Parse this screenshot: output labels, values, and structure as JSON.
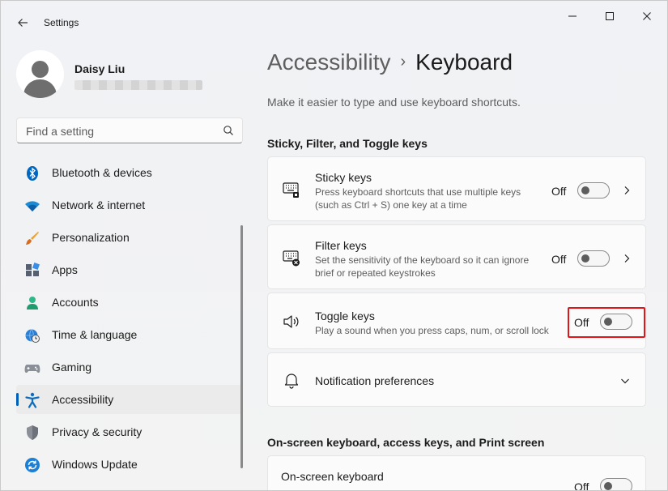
{
  "window": {
    "title": "Settings",
    "controls": {
      "minimize": "minimize",
      "maximize": "maximize",
      "close": "close"
    }
  },
  "user": {
    "name": "Daisy Liu"
  },
  "search": {
    "placeholder": "Find a setting"
  },
  "sidebar": {
    "items": [
      {
        "label": "Bluetooth & devices",
        "icon": "bluetooth-icon"
      },
      {
        "label": "Network & internet",
        "icon": "wifi-icon"
      },
      {
        "label": "Personalization",
        "icon": "brush-icon"
      },
      {
        "label": "Apps",
        "icon": "apps-icon"
      },
      {
        "label": "Accounts",
        "icon": "accounts-icon"
      },
      {
        "label": "Time & language",
        "icon": "globe-clock-icon"
      },
      {
        "label": "Gaming",
        "icon": "gamepad-icon"
      },
      {
        "label": "Accessibility",
        "icon": "accessibility-icon",
        "active": true
      },
      {
        "label": "Privacy & security",
        "icon": "shield-icon"
      },
      {
        "label": "Windows Update",
        "icon": "update-icon"
      }
    ]
  },
  "breadcrumb": {
    "parent": "Accessibility",
    "separator": "›",
    "current": "Keyboard"
  },
  "subtitle": "Make it easier to type and use keyboard shortcuts.",
  "sections": {
    "sticky": {
      "title": "Sticky, Filter, and Toggle keys"
    },
    "onscreen": {
      "title": "On-screen keyboard, access keys, and Print screen"
    }
  },
  "cards": {
    "sticky_keys": {
      "title": "Sticky keys",
      "desc": "Press keyboard shortcuts that use multiple keys (such as Ctrl + S) one key at a time",
      "state": "Off"
    },
    "filter_keys": {
      "title": "Filter keys",
      "desc": "Set the sensitivity of the keyboard so it can ignore brief or repeated keystrokes",
      "state": "Off"
    },
    "toggle_keys": {
      "title": "Toggle keys",
      "desc": "Play a sound when you press caps, num, or scroll lock",
      "state": "Off"
    },
    "notification_prefs": {
      "title": "Notification preferences"
    },
    "onscreen_keyboard": {
      "title": "On-screen keyboard",
      "state": "Off"
    }
  },
  "colors": {
    "accent": "#005fb8",
    "highlight": "#e0161b"
  }
}
